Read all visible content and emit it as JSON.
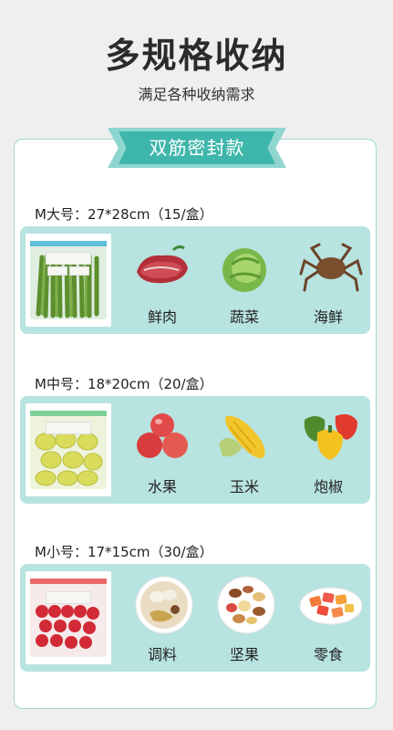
{
  "header": {
    "title": "多规格收纳",
    "subtitle": "满足各种收纳需求"
  },
  "banner": {
    "label": "双筋密封款"
  },
  "sizes": [
    {
      "label": "M大号：27*28cm（15/盒）",
      "items": [
        {
          "label": "鲜肉",
          "icon": "steak-icon"
        },
        {
          "label": "蔬菜",
          "icon": "cabbage-icon"
        },
        {
          "label": "海鲜",
          "icon": "crab-icon"
        }
      ]
    },
    {
      "label": "M中号：18*20cm（20/盒）",
      "items": [
        {
          "label": "水果",
          "icon": "apples-icon"
        },
        {
          "label": "玉米",
          "icon": "corn-icon"
        },
        {
          "label": "炮椒",
          "icon": "peppers-icon"
        }
      ]
    },
    {
      "label": "M小号：17*15cm（30/盒）",
      "items": [
        {
          "label": "调料",
          "icon": "spices-icon"
        },
        {
          "label": "坚果",
          "icon": "nuts-icon"
        },
        {
          "label": "零食",
          "icon": "snacks-icon"
        }
      ]
    }
  ],
  "colors": {
    "accent": "#3fb6ab",
    "row_bg": "#b7e3e0",
    "seal_blue": "#5ec0d8",
    "seal_green": "#7fcf9a",
    "seal_red": "#ea6a6a"
  }
}
